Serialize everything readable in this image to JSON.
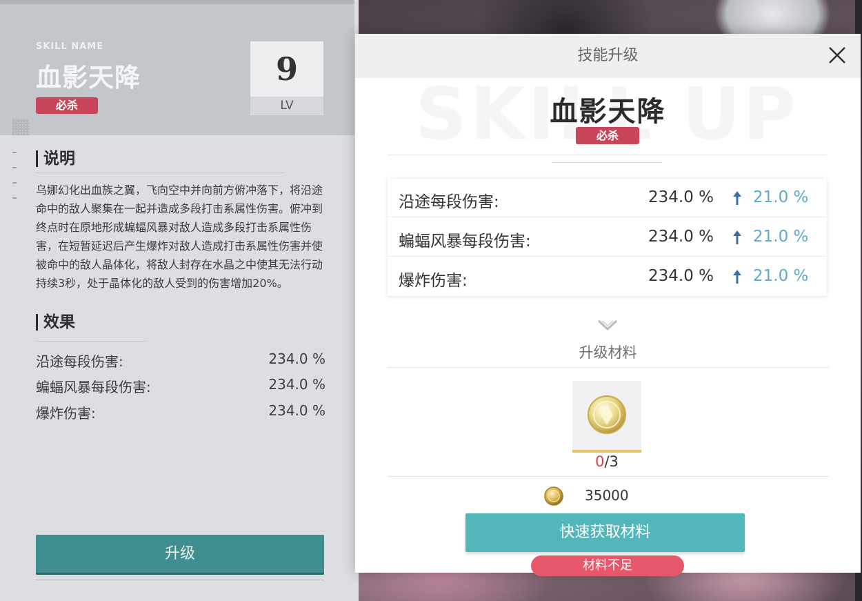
{
  "left_panel": {
    "skill_name_label": "SKILL NAME",
    "skill_title": "血影天降",
    "tag": "必杀",
    "level": "9",
    "level_label": "LV",
    "description_heading": "说明",
    "description": "乌娜幻化出血族之翼，飞向空中并向前方俯冲落下，将沿途命中的敌人聚集在一起并造成多段打击系属性伤害。俯冲到终点时在原地形成蝙蝠风暴对敌人造成多段打击系属性伤害，在短暂延迟后产生爆炸对敌人造成打击系属性伤害并使被命中的敌人晶体化，将敌人封存在水晶之中使其无法行动持续3秒，处于晶体化的敌人受到的伤害增加20%。",
    "effects_heading": "效果",
    "effects": [
      {
        "label": "沿途每段伤害:",
        "value": "234.0 %"
      },
      {
        "label": "蝙蝠风暴每段伤害:",
        "value": "234.0 %"
      },
      {
        "label": "爆炸伤害:",
        "value": "234.0 %"
      }
    ],
    "upgrade_button": "升级"
  },
  "modal": {
    "title": "技能升级",
    "watermark": "SKILL UP",
    "skill_title": "血影天降",
    "tag": "必杀",
    "stats": [
      {
        "label": "沿途每段伤害:",
        "value": "234.0 %",
        "increase": "21.0 %"
      },
      {
        "label": "蝙蝠风暴每段伤害:",
        "value": "234.0 %",
        "increase": "21.0 %"
      },
      {
        "label": "爆炸伤害:",
        "value": "234.0 %",
        "increase": "21.0 %"
      }
    ],
    "materials_label": "升级材料",
    "material": {
      "icon": "material-coin-icon",
      "have": "0",
      "need": "/3"
    },
    "gold_cost": "35000",
    "quick_get_button": "快速获取材料",
    "insufficient_label": "材料不足"
  },
  "colors": {
    "accent_teal": "#52b6ba",
    "upgrade_teal": "#3f8e90",
    "tag_red": "#c9455a",
    "increase_blue": "#5fa9c9",
    "warning_red": "#e5586b"
  }
}
